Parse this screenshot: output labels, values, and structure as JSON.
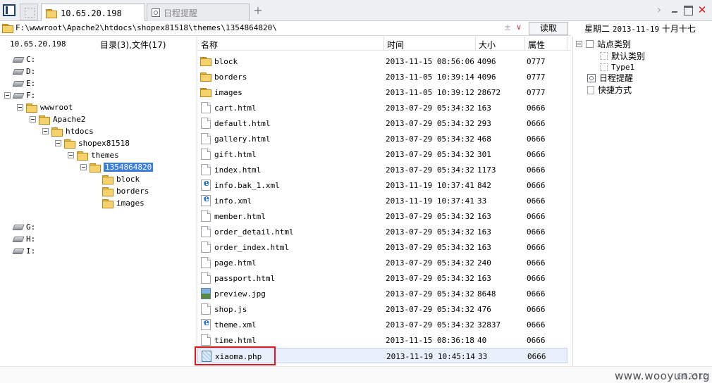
{
  "tabs": [
    {
      "label": "10.65.20.198",
      "icon": "folder-icon",
      "active": true
    },
    {
      "label": "日程提醒",
      "icon": "clock-icon",
      "active": false
    }
  ],
  "address": {
    "path": "F:\\wwwroot\\Apache2\\htdocs\\shopex81518\\themes\\1354864820\\",
    "plus_minus": "±",
    "read_label": "读取"
  },
  "date_line": {
    "weekday": "星期二",
    "date": "2013-11-19",
    "lunar": "十月十七"
  },
  "left": {
    "ip": "10.65.20.198",
    "summary": "目录(3),文件(17)",
    "tree": [
      {
        "label": "C:",
        "type": "drive",
        "level": 0,
        "expander": false
      },
      {
        "label": "D:",
        "type": "drive",
        "level": 0,
        "expander": false
      },
      {
        "label": "E:",
        "type": "drive",
        "level": 0,
        "expander": false
      },
      {
        "label": "F:",
        "type": "drive",
        "level": 0,
        "expander": true
      },
      {
        "label": "wwwroot",
        "type": "folder",
        "level": 1,
        "expander": true
      },
      {
        "label": "Apache2",
        "type": "folder",
        "level": 2,
        "expander": true
      },
      {
        "label": "htdocs",
        "type": "folder",
        "level": 3,
        "expander": true
      },
      {
        "label": "shopex81518",
        "type": "folder",
        "level": 4,
        "expander": true
      },
      {
        "label": "themes",
        "type": "folder",
        "level": 5,
        "expander": true
      },
      {
        "label": "1354864820",
        "type": "folder",
        "level": 6,
        "expander": true,
        "selected": true
      },
      {
        "label": "block",
        "type": "folder",
        "level": 7,
        "expander": false
      },
      {
        "label": "borders",
        "type": "folder",
        "level": 7,
        "expander": false
      },
      {
        "label": "images",
        "type": "folder",
        "level": 7,
        "expander": false
      },
      {
        "label": "G:",
        "type": "drive",
        "level": 0,
        "expander": false,
        "gap": true
      },
      {
        "label": "H:",
        "type": "drive",
        "level": 0,
        "expander": false
      },
      {
        "label": "I:",
        "type": "drive",
        "level": 0,
        "expander": false
      }
    ]
  },
  "columns": {
    "name": "名称",
    "time": "时间",
    "size": "大小",
    "attr": "属性"
  },
  "files": [
    {
      "name": "block",
      "time": "2013-11-15 08:56:06",
      "size": "4096",
      "attr": "0777",
      "kind": "folder"
    },
    {
      "name": "borders",
      "time": "2013-11-05 10:39:14",
      "size": "4096",
      "attr": "0777",
      "kind": "folder"
    },
    {
      "name": "images",
      "time": "2013-11-05 10:39:12",
      "size": "28672",
      "attr": "0777",
      "kind": "folder"
    },
    {
      "name": "cart.html",
      "time": "2013-07-29 05:34:32",
      "size": "163",
      "attr": "0666",
      "kind": "doc"
    },
    {
      "name": "default.html",
      "time": "2013-07-29 05:34:32",
      "size": "293",
      "attr": "0666",
      "kind": "doc"
    },
    {
      "name": "gallery.html",
      "time": "2013-07-29 05:34:32",
      "size": "468",
      "attr": "0666",
      "kind": "doc"
    },
    {
      "name": "gift.html",
      "time": "2013-07-29 05:34:32",
      "size": "301",
      "attr": "0666",
      "kind": "doc"
    },
    {
      "name": "index.html",
      "time": "2013-07-29 05:34:32",
      "size": "1173",
      "attr": "0666",
      "kind": "doc"
    },
    {
      "name": "info.bak_1.xml",
      "time": "2013-11-19 10:37:41",
      "size": "842",
      "attr": "0666",
      "kind": "ie"
    },
    {
      "name": "info.xml",
      "time": "2013-11-19 10:37:41",
      "size": "33",
      "attr": "0666",
      "kind": "ie"
    },
    {
      "name": "member.html",
      "time": "2013-07-29 05:34:32",
      "size": "163",
      "attr": "0666",
      "kind": "doc"
    },
    {
      "name": "order_detail.html",
      "time": "2013-07-29 05:34:32",
      "size": "163",
      "attr": "0666",
      "kind": "doc"
    },
    {
      "name": "order_index.html",
      "time": "2013-07-29 05:34:32",
      "size": "163",
      "attr": "0666",
      "kind": "doc"
    },
    {
      "name": "page.html",
      "time": "2013-07-29 05:34:32",
      "size": "240",
      "attr": "0666",
      "kind": "doc"
    },
    {
      "name": "passport.html",
      "time": "2013-07-29 05:34:32",
      "size": "163",
      "attr": "0666",
      "kind": "doc"
    },
    {
      "name": "preview.jpg",
      "time": "2013-07-29 05:34:32",
      "size": "8648",
      "attr": "0666",
      "kind": "img"
    },
    {
      "name": "shop.js",
      "time": "2013-07-29 05:34:32",
      "size": "476",
      "attr": "0666",
      "kind": "doc"
    },
    {
      "name": "theme.xml",
      "time": "2013-07-29 05:34:32",
      "size": "32837",
      "attr": "0666",
      "kind": "ie"
    },
    {
      "name": "time.html",
      "time": "2013-11-15 08:36:18",
      "size": "40",
      "attr": "0666",
      "kind": "doc"
    },
    {
      "name": "xiaoma.php",
      "time": "2013-11-19 10:45:14",
      "size": "33",
      "attr": "0666",
      "kind": "php",
      "highlighted": true
    }
  ],
  "right": {
    "site_category": "站点类别",
    "default_category": "默认类别",
    "type1": "Type1",
    "schedule": "日程提醒",
    "shortcut": "快捷方式"
  },
  "footer": {
    "watermark": "www.wooyun.org",
    "watermark_gray": "GB2312"
  },
  "colors": {
    "highlight_box": "#e0161c",
    "selection": "#3d7ddc",
    "close": "#d4161b"
  }
}
